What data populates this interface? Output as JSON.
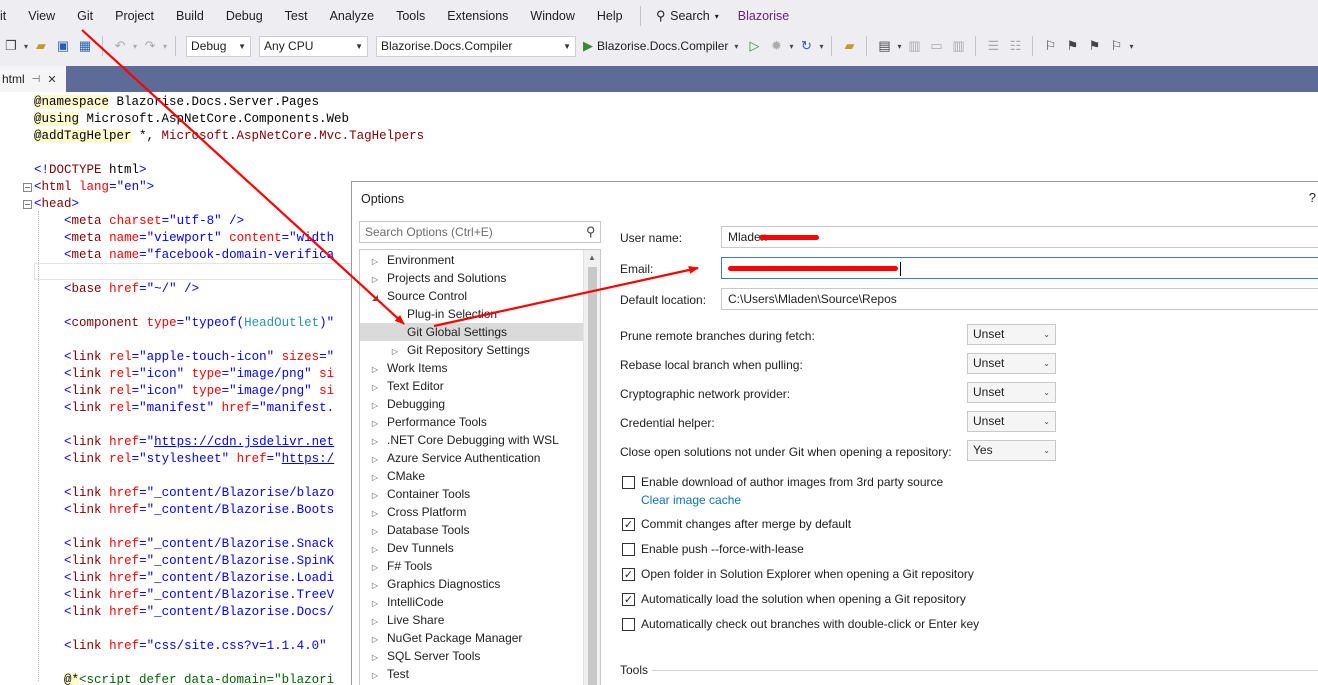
{
  "menu": [
    "it",
    "View",
    "Git",
    "Project",
    "Build",
    "Debug",
    "Test",
    "Analyze",
    "Tools",
    "Extensions",
    "Window",
    "Help"
  ],
  "search_label": "Search",
  "app_name": "Blazorise",
  "toolbar": {
    "config": "Debug",
    "platform": "Any CPU",
    "startup_project": "Blazorise.Docs.Compiler",
    "run_label": "Blazorise.Docs.Compiler"
  },
  "tab": {
    "label": "html"
  },
  "code": [
    {
      "row": 0,
      "fold": "",
      "parts": [
        [
          "k-dir",
          "@namespace"
        ],
        [
          "k-txt",
          " Blazorise.Docs.Server.Pages"
        ]
      ]
    },
    {
      "row": 1,
      "fold": "",
      "parts": [
        [
          "k-dir",
          "@using"
        ],
        [
          "k-txt",
          " Microsoft.AspNetCore.Components.Web"
        ]
      ]
    },
    {
      "row": 2,
      "fold": "",
      "parts": [
        [
          "k-dir",
          "@addTagHelper"
        ],
        [
          "k-txt",
          " *, "
        ],
        [
          "k-tag",
          "Microsoft.AspNetCore.Mvc.TagHelpers"
        ]
      ]
    },
    {
      "row": 4,
      "fold": "",
      "parts": [
        [
          "k-val",
          "<!"
        ],
        [
          "k-tag",
          "DOCTYPE"
        ],
        [
          "k-txt",
          " html"
        ],
        [
          "k-val",
          ">"
        ]
      ]
    },
    {
      "row": 5,
      "fold": "−",
      "parts": [
        [
          "k-val",
          "<"
        ],
        [
          "k-tag",
          "html"
        ],
        [
          "k-txt",
          " "
        ],
        [
          "k-attr",
          "lang"
        ],
        [
          "k-val",
          "=\"en\">"
        ]
      ]
    },
    {
      "row": 6,
      "fold": "−",
      "parts": [
        [
          "k-val",
          "<"
        ],
        [
          "k-tag",
          "head"
        ],
        [
          "k-val",
          ">"
        ]
      ]
    },
    {
      "row": 7,
      "fold": "",
      "parts": [
        [
          "k-txt",
          "    "
        ],
        [
          "k-val",
          "<"
        ],
        [
          "k-tag",
          "meta"
        ],
        [
          "k-txt",
          " "
        ],
        [
          "k-attr",
          "charset"
        ],
        [
          "k-val",
          "=\"utf-8\" />"
        ]
      ]
    },
    {
      "row": 8,
      "fold": "",
      "parts": [
        [
          "k-txt",
          "    "
        ],
        [
          "k-val",
          "<"
        ],
        [
          "k-tag",
          "meta"
        ],
        [
          "k-txt",
          " "
        ],
        [
          "k-attr",
          "name"
        ],
        [
          "k-val",
          "=\"viewport\""
        ],
        [
          "k-txt",
          " "
        ],
        [
          "k-attr",
          "content"
        ],
        [
          "k-val",
          "=\"width"
        ]
      ]
    },
    {
      "row": 9,
      "fold": "",
      "parts": [
        [
          "k-txt",
          "    "
        ],
        [
          "k-val",
          "<"
        ],
        [
          "k-tag",
          "meta"
        ],
        [
          "k-txt",
          " "
        ],
        [
          "k-attr",
          "name"
        ],
        [
          "k-val",
          "=\"facebook-domain-verifica"
        ]
      ]
    },
    {
      "row": 11,
      "fold": "",
      "parts": [
        [
          "k-txt",
          "    "
        ],
        [
          "k-val",
          "<"
        ],
        [
          "k-tag",
          "base"
        ],
        [
          "k-txt",
          " "
        ],
        [
          "k-attr",
          "href"
        ],
        [
          "k-val",
          "=\"~/\" />"
        ]
      ]
    },
    {
      "row": 13,
      "fold": "",
      "parts": [
        [
          "k-txt",
          "    "
        ],
        [
          "k-val",
          "<"
        ],
        [
          "k-tag",
          "component"
        ],
        [
          "k-txt",
          " "
        ],
        [
          "k-attr",
          "type"
        ],
        [
          "k-val",
          "=\"typeof("
        ],
        [
          "k-type",
          "HeadOutlet"
        ],
        [
          "k-val",
          ")\""
        ]
      ]
    },
    {
      "row": 15,
      "fold": "",
      "parts": [
        [
          "k-txt",
          "    "
        ],
        [
          "k-val",
          "<"
        ],
        [
          "k-tag",
          "link"
        ],
        [
          "k-txt",
          " "
        ],
        [
          "k-attr",
          "rel"
        ],
        [
          "k-val",
          "=\"apple-touch-icon\""
        ],
        [
          "k-txt",
          " "
        ],
        [
          "k-attr",
          "sizes"
        ],
        [
          "k-val",
          "=\""
        ]
      ]
    },
    {
      "row": 16,
      "fold": "",
      "parts": [
        [
          "k-txt",
          "    "
        ],
        [
          "k-val",
          "<"
        ],
        [
          "k-tag",
          "link"
        ],
        [
          "k-txt",
          " "
        ],
        [
          "k-attr",
          "rel"
        ],
        [
          "k-val",
          "=\"icon\""
        ],
        [
          "k-txt",
          " "
        ],
        [
          "k-attr",
          "type"
        ],
        [
          "k-val",
          "=\"image/png\""
        ],
        [
          "k-txt",
          " "
        ],
        [
          "k-attr",
          "si"
        ]
      ]
    },
    {
      "row": 17,
      "fold": "",
      "parts": [
        [
          "k-txt",
          "    "
        ],
        [
          "k-val",
          "<"
        ],
        [
          "k-tag",
          "link"
        ],
        [
          "k-txt",
          " "
        ],
        [
          "k-attr",
          "rel"
        ],
        [
          "k-val",
          "=\"icon\""
        ],
        [
          "k-txt",
          " "
        ],
        [
          "k-attr",
          "type"
        ],
        [
          "k-val",
          "=\"image/png\""
        ],
        [
          "k-txt",
          " "
        ],
        [
          "k-attr",
          "si"
        ]
      ]
    },
    {
      "row": 18,
      "fold": "",
      "parts": [
        [
          "k-txt",
          "    "
        ],
        [
          "k-val",
          "<"
        ],
        [
          "k-tag",
          "link"
        ],
        [
          "k-txt",
          " "
        ],
        [
          "k-attr",
          "rel"
        ],
        [
          "k-val",
          "=\"manifest\""
        ],
        [
          "k-txt",
          " "
        ],
        [
          "k-attr",
          "href"
        ],
        [
          "k-val",
          "=\"manifest."
        ]
      ]
    },
    {
      "row": 20,
      "fold": "",
      "parts": [
        [
          "k-txt",
          "    "
        ],
        [
          "k-val",
          "<"
        ],
        [
          "k-tag",
          "link"
        ],
        [
          "k-txt",
          " "
        ],
        [
          "k-attr",
          "href"
        ],
        [
          "k-val",
          "=\""
        ],
        [
          "k-link",
          "https://cdn.jsdelivr.net"
        ]
      ]
    },
    {
      "row": 21,
      "fold": "",
      "parts": [
        [
          "k-txt",
          "    "
        ],
        [
          "k-val",
          "<"
        ],
        [
          "k-tag",
          "link"
        ],
        [
          "k-txt",
          " "
        ],
        [
          "k-attr",
          "rel"
        ],
        [
          "k-val",
          "=\"stylesheet\""
        ],
        [
          "k-txt",
          " "
        ],
        [
          "k-attr",
          "href"
        ],
        [
          "k-val",
          "=\""
        ],
        [
          "k-link",
          "https:/"
        ]
      ]
    },
    {
      "row": 23,
      "fold": "",
      "parts": [
        [
          "k-txt",
          "    "
        ],
        [
          "k-val",
          "<"
        ],
        [
          "k-tag",
          "link"
        ],
        [
          "k-txt",
          " "
        ],
        [
          "k-attr",
          "href"
        ],
        [
          "k-val",
          "=\"_content/Blazorise/blazo"
        ]
      ]
    },
    {
      "row": 24,
      "fold": "",
      "parts": [
        [
          "k-txt",
          "    "
        ],
        [
          "k-val",
          "<"
        ],
        [
          "k-tag",
          "link"
        ],
        [
          "k-txt",
          " "
        ],
        [
          "k-attr",
          "href"
        ],
        [
          "k-val",
          "=\"_content/Blazorise.Boots"
        ]
      ]
    },
    {
      "row": 26,
      "fold": "",
      "parts": [
        [
          "k-txt",
          "    "
        ],
        [
          "k-val",
          "<"
        ],
        [
          "k-tag",
          "link"
        ],
        [
          "k-txt",
          " "
        ],
        [
          "k-attr",
          "href"
        ],
        [
          "k-val",
          "=\"_content/Blazorise.Snack"
        ]
      ]
    },
    {
      "row": 27,
      "fold": "",
      "parts": [
        [
          "k-txt",
          "    "
        ],
        [
          "k-val",
          "<"
        ],
        [
          "k-tag",
          "link"
        ],
        [
          "k-txt",
          " "
        ],
        [
          "k-attr",
          "href"
        ],
        [
          "k-val",
          "=\"_content/Blazorise.SpinK"
        ]
      ]
    },
    {
      "row": 28,
      "fold": "",
      "parts": [
        [
          "k-txt",
          "    "
        ],
        [
          "k-val",
          "<"
        ],
        [
          "k-tag",
          "link"
        ],
        [
          "k-txt",
          " "
        ],
        [
          "k-attr",
          "href"
        ],
        [
          "k-val",
          "=\"_content/Blazorise.Loadi"
        ]
      ]
    },
    {
      "row": 29,
      "fold": "",
      "parts": [
        [
          "k-txt",
          "    "
        ],
        [
          "k-val",
          "<"
        ],
        [
          "k-tag",
          "link"
        ],
        [
          "k-txt",
          " "
        ],
        [
          "k-attr",
          "href"
        ],
        [
          "k-val",
          "=\"_content/Blazorise.TreeV"
        ]
      ]
    },
    {
      "row": 30,
      "fold": "",
      "parts": [
        [
          "k-txt",
          "    "
        ],
        [
          "k-val",
          "<"
        ],
        [
          "k-tag",
          "link"
        ],
        [
          "k-txt",
          " "
        ],
        [
          "k-attr",
          "href"
        ],
        [
          "k-val",
          "=\"_content/Blazorise.Docs/"
        ]
      ]
    },
    {
      "row": 32,
      "fold": "",
      "parts": [
        [
          "k-txt",
          "    "
        ],
        [
          "k-val",
          "<"
        ],
        [
          "k-tag",
          "link"
        ],
        [
          "k-txt",
          " "
        ],
        [
          "k-attr",
          "href"
        ],
        [
          "k-val",
          "=\"css/site.css?v=1.1.4.0\""
        ]
      ]
    },
    {
      "row": 34,
      "fold": "",
      "parts": [
        [
          "k-txt",
          "    "
        ],
        [
          "k-at",
          "@*"
        ],
        [
          "k-cmt",
          "<script defer data-domain=\"blazori"
        ]
      ]
    }
  ],
  "options": {
    "title": "Options",
    "help": "?",
    "search_placeholder": "Search Options (Ctrl+E)",
    "tree": [
      {
        "label": "Environment",
        "exp": "▷",
        "level": 0
      },
      {
        "label": "Projects and Solutions",
        "exp": "▷",
        "level": 0
      },
      {
        "label": "Source Control",
        "exp": "◢",
        "level": 0
      },
      {
        "label": "Plug-in Selection",
        "exp": "",
        "level": 1
      },
      {
        "label": "Git Global Settings",
        "exp": "",
        "level": 1,
        "selected": true
      },
      {
        "label": "Git Repository Settings",
        "exp": "▷",
        "level": 1
      },
      {
        "label": "Work Items",
        "exp": "▷",
        "level": 0
      },
      {
        "label": "Text Editor",
        "exp": "▷",
        "level": 0
      },
      {
        "label": "Debugging",
        "exp": "▷",
        "level": 0
      },
      {
        "label": "Performance Tools",
        "exp": "▷",
        "level": 0
      },
      {
        "label": ".NET Core Debugging with WSL",
        "exp": "▷",
        "level": 0
      },
      {
        "label": "Azure Service Authentication",
        "exp": "▷",
        "level": 0
      },
      {
        "label": "CMake",
        "exp": "▷",
        "level": 0
      },
      {
        "label": "Container Tools",
        "exp": "▷",
        "level": 0
      },
      {
        "label": "Cross Platform",
        "exp": "▷",
        "level": 0
      },
      {
        "label": "Database Tools",
        "exp": "▷",
        "level": 0
      },
      {
        "label": "Dev Tunnels",
        "exp": "▷",
        "level": 0
      },
      {
        "label": "F# Tools",
        "exp": "▷",
        "level": 0
      },
      {
        "label": "Graphics Diagnostics",
        "exp": "▷",
        "level": 0
      },
      {
        "label": "IntelliCode",
        "exp": "▷",
        "level": 0
      },
      {
        "label": "Live Share",
        "exp": "▷",
        "level": 0
      },
      {
        "label": "NuGet Package Manager",
        "exp": "▷",
        "level": 0
      },
      {
        "label": "SQL Server Tools",
        "exp": "▷",
        "level": 0
      },
      {
        "label": "Test",
        "exp": "▷",
        "level": 0
      }
    ],
    "user_name_label": "User name:",
    "user_name_value": "Mladen",
    "email_label": "Email:",
    "location_label": "Default location:",
    "location_value": "C:\\Users\\Mladen\\Source\\Repos",
    "dropdowns": [
      {
        "label": "Prune remote branches during fetch:",
        "value": "Unset"
      },
      {
        "label": "Rebase local branch when pulling:",
        "value": "Unset"
      },
      {
        "label": "Cryptographic network provider:",
        "value": "Unset"
      },
      {
        "label": "Credential helper:",
        "value": "Unset"
      },
      {
        "label": "Close open solutions not under Git when opening a repository:",
        "value": "Yes"
      }
    ],
    "checkboxes": [
      {
        "label": "Enable download of author images from 3rd party source",
        "checked": false
      },
      {
        "label": "Commit changes after merge by default",
        "checked": true
      },
      {
        "label": "Enable push --force-with-lease",
        "checked": false
      },
      {
        "label": "Open folder in Solution Explorer when opening a Git repository",
        "checked": true
      },
      {
        "label": "Automatically load the solution when opening a Git repository",
        "checked": true
      },
      {
        "label": "Automatically check out branches with double-click or Enter key",
        "checked": false
      }
    ],
    "clear_cache_link": "Clear image cache",
    "tools_group": "Tools"
  },
  "annotation_color": "#ff0000"
}
